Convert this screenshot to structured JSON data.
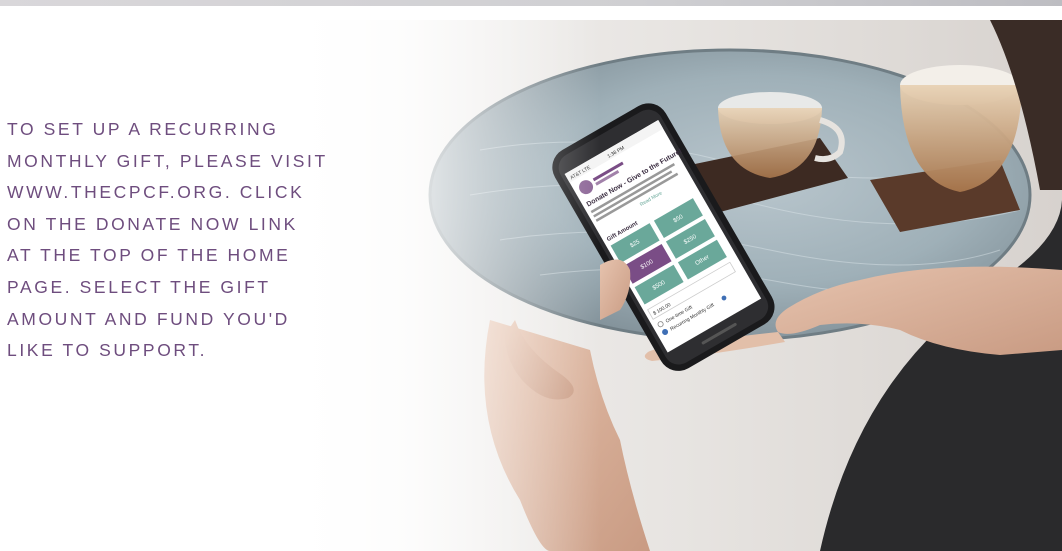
{
  "instructions": {
    "lines": [
      "TO SET UP A RECURRING",
      "MONTHLY GIFT, PLEASE VISIT",
      "WWW.THECPCF.ORG. CLICK",
      "ON THE DONATE NOW LINK",
      "AT THE TOP OF THE HOME",
      "PAGE. SELECT THE GIFT",
      "AMOUNT AND FUND YOU'D",
      "LIKE TO SUPPORT."
    ]
  },
  "phone": {
    "carrier": "AT&T LTE",
    "time": "1:38 PM",
    "heading": "Donate Now - Give to the Future!",
    "read_more": "Read More",
    "gift_amount_label": "Gift Amount",
    "amounts": [
      "$25",
      "$50",
      "$100",
      "$250",
      "$500",
      "Other"
    ],
    "selected_amount": "$100",
    "amount_value": "$ 100.00",
    "one_time_label": "One-time Gift",
    "recurring_label": "Recurring Monthly Gift",
    "selected_frequency": "Recurring Monthly Gift"
  },
  "colors": {
    "text_purple": "#6e4d7e",
    "button_green": "#6aa89a",
    "button_selected": "#7a4d86"
  }
}
